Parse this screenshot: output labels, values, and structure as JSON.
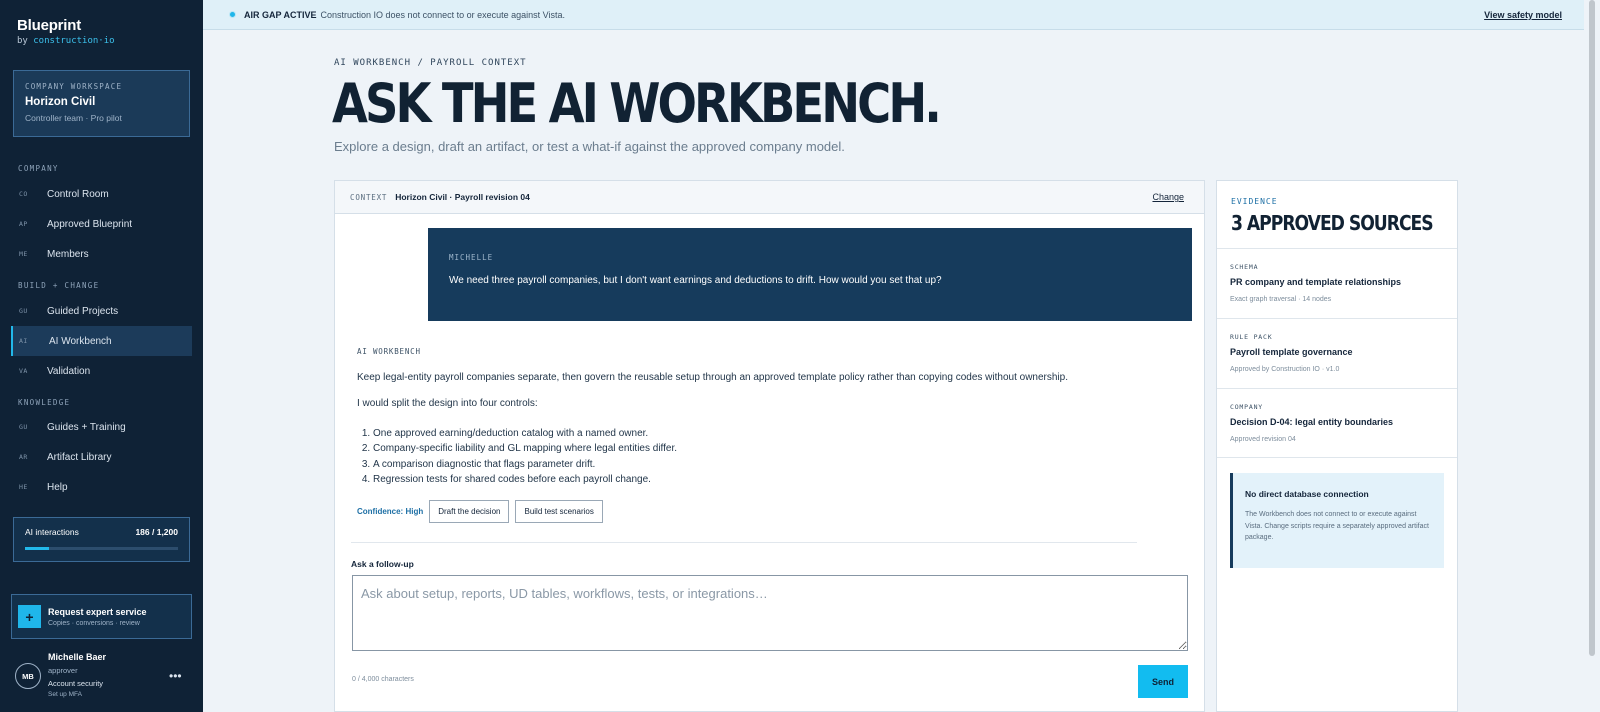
{
  "brand": {
    "name": "Blueprint",
    "sub_prefix": "by",
    "sub_accent": "construction·io"
  },
  "workspace": {
    "label": "COMPANY WORKSPACE",
    "name": "Horizon Civil",
    "sub": "Controller team · Pro pilot"
  },
  "nav": {
    "sections": [
      {
        "label": "COMPANY",
        "items": [
          {
            "abbr": "CO",
            "label": "Control Room"
          },
          {
            "abbr": "AP",
            "label": "Approved Blueprint"
          },
          {
            "abbr": "ME",
            "label": "Members"
          }
        ]
      },
      {
        "label": "BUILD + CHANGE",
        "items": [
          {
            "abbr": "GU",
            "label": "Guided Projects"
          },
          {
            "abbr": "AI",
            "label": "AI Workbench",
            "active": true
          },
          {
            "abbr": "VA",
            "label": "Validation"
          }
        ]
      },
      {
        "label": "KNOWLEDGE",
        "items": [
          {
            "abbr": "GU",
            "label": "Guides + Training"
          },
          {
            "abbr": "AR",
            "label": "Artifact Library"
          },
          {
            "abbr": "HE",
            "label": "Help"
          }
        ]
      }
    ]
  },
  "usage": {
    "label": "AI interactions",
    "count": "186 / 1,200",
    "fraction": 0.155
  },
  "expert": {
    "icon": "+",
    "title": "Request expert service",
    "sub": "Copies · conversions · review"
  },
  "user": {
    "initials": "MB",
    "name": "Michelle Baer",
    "role": "approver",
    "security": "Account security",
    "mfa": "Set up MFA",
    "more": "•••"
  },
  "banner": {
    "strong": "AIR GAP ACTIVE",
    "text": "Construction IO does not connect to or execute against Vista.",
    "link": "View safety model"
  },
  "header": {
    "breadcrumb": "AI WORKBENCH / PAYROLL CONTEXT",
    "title": "ASK THE AI WORKBENCH.",
    "subtitle": "Explore a design, draft an artifact, or test a what-if against the approved company model."
  },
  "context": {
    "label": "CONTEXT",
    "value": "Horizon Civil · Payroll revision 04",
    "change": "Change"
  },
  "conversation": {
    "user_message": {
      "author": "MICHELLE",
      "text": "We need three payroll companies, but I don't want earnings and deductions to drift. How would you set that up?"
    },
    "ai_response": {
      "author": "AI WORKBENCH",
      "p1": "Keep legal-entity payroll companies separate, then govern the reusable setup through an approved template policy rather than copying codes without ownership.",
      "p2": "I would split the design into four controls:",
      "list": [
        "One approved earning/deduction catalog with a named owner.",
        "Company-specific liability and GL mapping where legal entities differ.",
        "A comparison diagnostic that flags parameter drift.",
        "Regression tests for shared codes before each payroll change."
      ],
      "confidence": "Confidence: High",
      "actions": [
        "Draft the decision",
        "Build test scenarios"
      ]
    }
  },
  "followup": {
    "label": "Ask a follow-up",
    "placeholder": "Ask about setup, reports, UD tables, workflows, tests, or integrations…",
    "char_count": "0 / 4,000 characters",
    "send": "Send"
  },
  "evidence": {
    "label": "EVIDENCE",
    "title": "3 APPROVED SOURCES",
    "items": [
      {
        "type": "SCHEMA",
        "name": "PR company and template relationships",
        "meta": "Exact graph traversal · 14 nodes"
      },
      {
        "type": "RULE PACK",
        "name": "Payroll template governance",
        "meta": "Approved by Construction IO · v1.0"
      },
      {
        "type": "COMPANY",
        "name": "Decision D-04: legal entity boundaries",
        "meta": "Approved revision 04"
      }
    ],
    "note": {
      "title": "No direct database connection",
      "body": "The Workbench does not connect to or execute against Vista. Change scripts require a separately approved artifact package."
    }
  },
  "colors": {
    "sidebar": "#0f2236",
    "accent": "#12bcf0",
    "message": "#163b5c"
  }
}
